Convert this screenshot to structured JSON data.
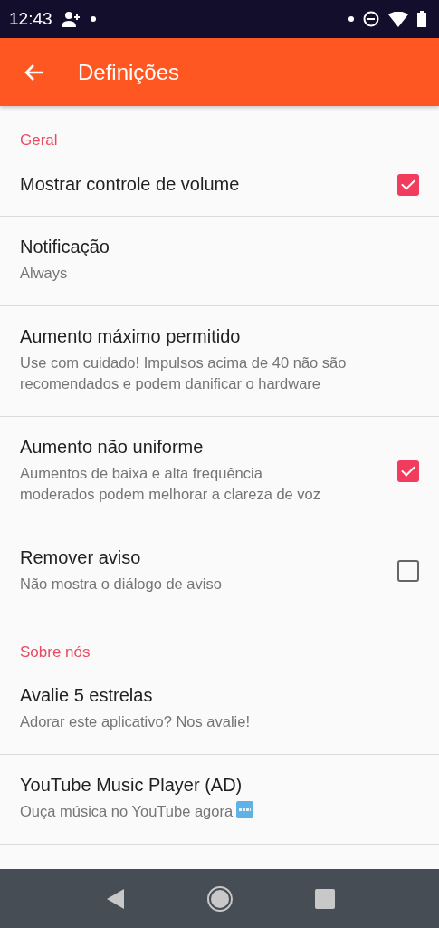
{
  "status_bar": {
    "time": "12:43"
  },
  "app_bar": {
    "title": "Definições"
  },
  "sections": [
    {
      "header": "Geral",
      "items": [
        {
          "kind": "checkbox",
          "title": "Mostrar controle de volume",
          "checked": true
        },
        {
          "kind": "plain",
          "title": "Notificação",
          "summary": "Always"
        },
        {
          "kind": "plain",
          "title": "Aumento máximo permitido",
          "summary": "Use com cuidado! Impulsos acima de 40 não são recomendados e podem danificar o hardware"
        },
        {
          "kind": "checkbox",
          "title": "Aumento não uniforme",
          "summary": "Aumentos de baixa e alta frequência moderados podem melhorar a clareza de voz",
          "checked": true
        },
        {
          "kind": "checkbox",
          "title": "Remover aviso",
          "summary": "Não mostra o diálogo de aviso",
          "checked": false
        }
      ]
    },
    {
      "header": "Sobre nós",
      "items": [
        {
          "kind": "plain",
          "title": "Avalie 5 estrelas",
          "summary": "Adorar este aplicativo? Nos avalie!"
        },
        {
          "kind": "badge",
          "title": "YouTube Music Player (AD)",
          "summary": "Ouça música no YouTube agora"
        }
      ]
    }
  ]
}
